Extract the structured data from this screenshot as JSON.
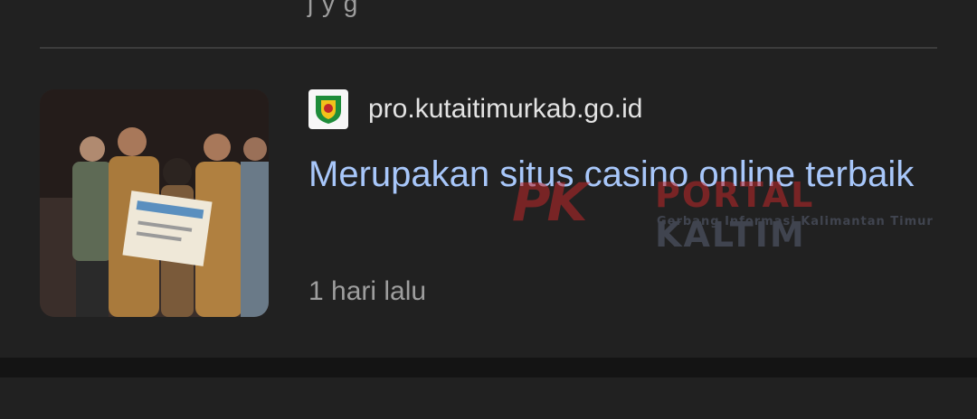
{
  "previous_item": {
    "fragment": "j  y  g"
  },
  "article": {
    "source": "pro.kutaitimurkab.go.id",
    "headline": "Merupakan situs casino online terbaik",
    "time": "1 hari lalu",
    "thumbnail_icon": "news-photo-ceremony",
    "favicon_icon": "kutai-timur-emblem-icon"
  },
  "watermark": {
    "logo": "PK",
    "title_part1": "PORTAL",
    "title_part2": "KALTIM",
    "tagline": "Gerbang Informasi Kalimantan Timur"
  },
  "colors": {
    "background": "#212121",
    "headline": "#a8c7fa",
    "source": "#e3e3e3",
    "meta": "#9e9e9e",
    "watermark_red": "#c0282a"
  }
}
